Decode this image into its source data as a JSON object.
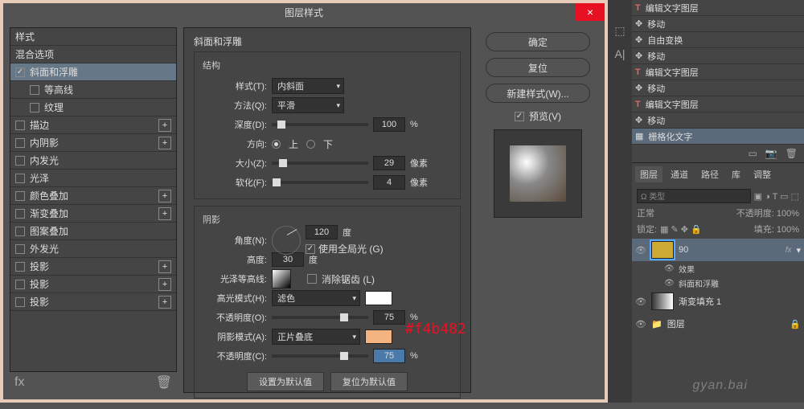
{
  "dialog": {
    "title": "图层样式",
    "left": {
      "header": "样式",
      "blend": "混合选项",
      "bevel": "斜面和浮雕",
      "contour": "等高线",
      "texture": "纹理",
      "stroke": "描边",
      "innerShadow": "内阴影",
      "innerGlow": "内发光",
      "satin": "光泽",
      "colorOverlay": "颜色叠加",
      "gradientOverlay": "渐变叠加",
      "patternOverlay": "图案叠加",
      "outerGlow": "外发光",
      "dropShadow1": "投影",
      "dropShadow2": "投影",
      "dropShadow3": "投影",
      "fxLabel": "fx",
      "trash": "🗑"
    },
    "mid": {
      "title": "斜面和浮雕",
      "structTitle": "结构",
      "styleLabel": "样式(T):",
      "styleVal": "内斜面",
      "techLabel": "方法(Q):",
      "techVal": "平滑",
      "depthLabel": "深度(D):",
      "depthVal": "100",
      "depthUnit": "%",
      "dirLabel": "方向:",
      "dirUp": "上",
      "dirDown": "下",
      "sizeLabel": "大小(Z):",
      "sizeVal": "29",
      "sizeUnit": "像素",
      "softLabel": "软化(F):",
      "softVal": "4",
      "softUnit": "像素",
      "shadeTitle": "阴影",
      "angleLabel": "角度(N):",
      "angleVal": "120",
      "angleUnit": "度",
      "globalLight": "使用全局光 (G)",
      "altLabel": "高度:",
      "altVal": "30",
      "altUnit": "度",
      "glossLabel": "光泽等高线:",
      "antialias": "消除锯齿 (L)",
      "hlModeLabel": "高光模式(H):",
      "hlModeVal": "滤色",
      "hlOpacLabel": "不透明度(O):",
      "hlOpacVal": "75",
      "hlOpacUnit": "%",
      "shModeLabel": "阴影模式(A):",
      "shModeVal": "正片叠底",
      "shOpacLabel": "不透明度(C):",
      "shOpacVal": "75",
      "shOpacUnit": "%",
      "defaultBtn": "设置为默认值",
      "resetBtn": "复位为默认值"
    },
    "right": {
      "ok": "确定",
      "cancel": "复位",
      "newStyle": "新建样式(W)...",
      "preview": "预览(V)"
    }
  },
  "annotation": "#f4b482",
  "side": {
    "layers": {
      "r1": "编辑文字图层",
      "r2": "移动",
      "r3": "自由变换",
      "r4": "移动",
      "r5": "编辑文字图层",
      "r6": "移动",
      "r7": "编辑文字图层",
      "r8": "移动",
      "r9": "栅格化文字"
    },
    "tabs": {
      "layers": "图层",
      "channels": "通道",
      "paths": "路径",
      "lib": "库",
      "adjust": "调整"
    },
    "kind": "Ω 类型",
    "normal": "正常",
    "opacity": "不透明度: 100%",
    "lock": "锁定:",
    "fill": "填充: 100%",
    "layer90": "90",
    "effects": "效果",
    "bevelEffect": "斜面和浮雕",
    "gradFill": "渐变填充 1",
    "layerGrp": "图层",
    "fxBadge": "fx"
  },
  "watermark": "gyan.bai"
}
